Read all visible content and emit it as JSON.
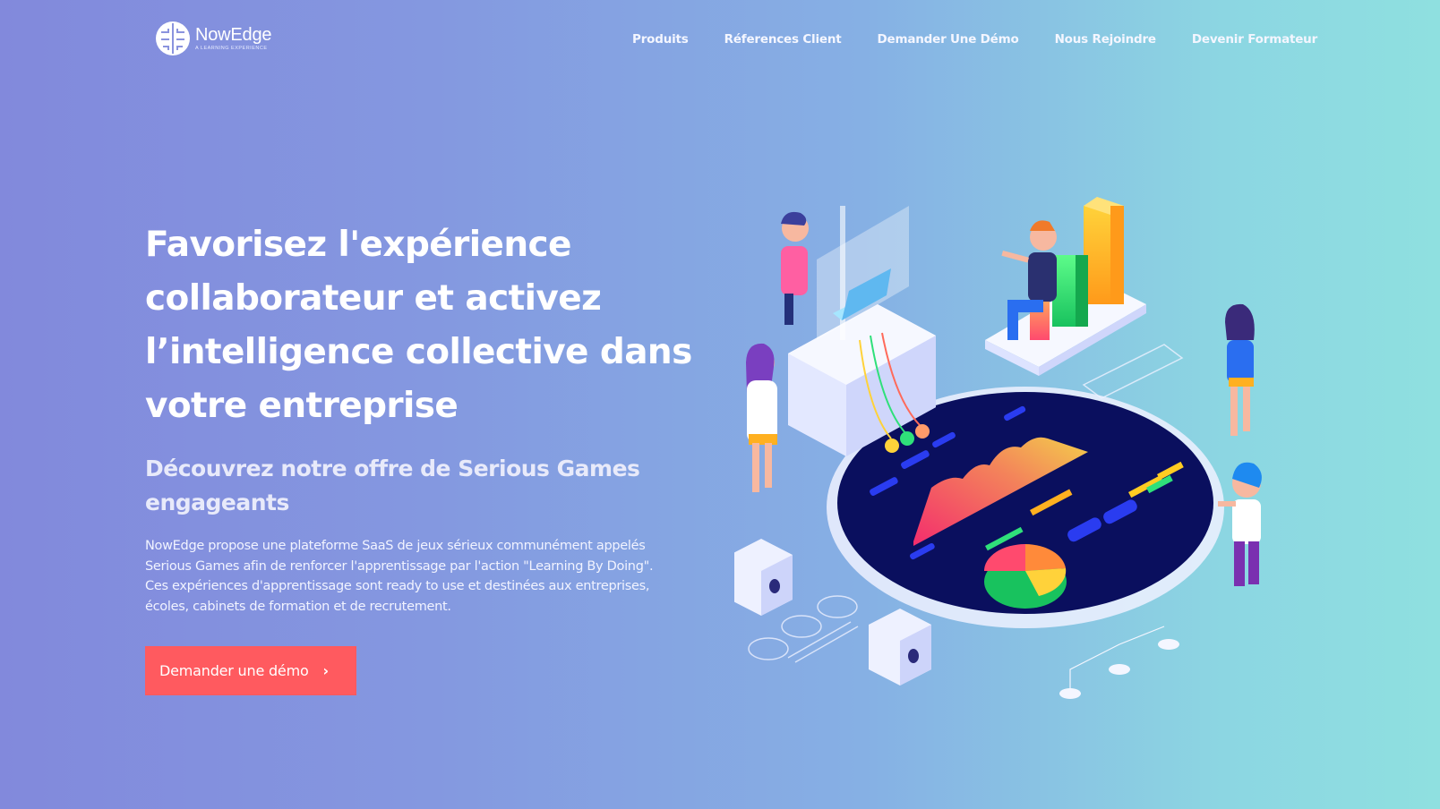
{
  "header": {
    "logo": {
      "name": "NowEdge",
      "tagline": "A LEARNING EXPERIENCE"
    },
    "nav": [
      {
        "label": "Produits"
      },
      {
        "label": "Réferences Client"
      },
      {
        "label": "Demander Une Démo"
      },
      {
        "label": "Nous Rejoindre"
      },
      {
        "label": "Devenir Formateur"
      }
    ]
  },
  "hero": {
    "title_lines": [
      "Favorisez l'expérience",
      "collaborateur et activez",
      "l’intelligence collective dans",
      "votre entreprise"
    ],
    "subtitle_lines": [
      "Découvrez notre offre de Serious Games",
      "engageants"
    ],
    "description_lines": [
      "NowEdge propose une plateforme SaaS de jeux sérieux communément appelés",
      "Serious Games afin de renforcer l'apprentissage par l'action \"Learning By Doing\".",
      "Ces expériences d'apprentissage sont ready to use et destinées aux entreprises,",
      "écoles, cabinets de formation et de recrutement."
    ],
    "cta_label": "Demander une démo",
    "cta_icon": "chevron-right-icon"
  },
  "colors": {
    "cta": "#ff5a5f",
    "platform_dark": "#0a0f5e",
    "gradient_start": "#8289dc",
    "gradient_end": "#8fe0e0"
  }
}
